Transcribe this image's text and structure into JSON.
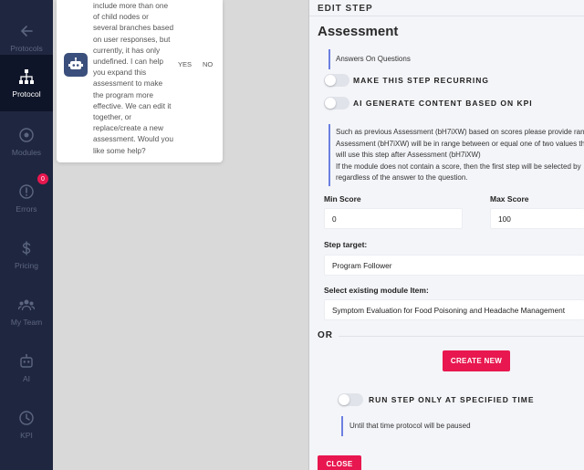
{
  "sidebar": {
    "items": [
      {
        "label": "Protocols",
        "icon": "arrow-left-icon"
      },
      {
        "label": "Protocol",
        "icon": "hierarchy-icon",
        "active": true
      },
      {
        "label": "Modules",
        "icon": "modules-icon"
      },
      {
        "label": "Errors",
        "icon": "error-icon",
        "badge": "0"
      },
      {
        "label": "Pricing",
        "icon": "dollar-icon"
      },
      {
        "label": "My Team",
        "icon": "team-icon"
      },
      {
        "label": "AI",
        "icon": "robot-icon"
      },
      {
        "label": "KPI",
        "icon": "clock-icon"
      }
    ]
  },
  "chat": {
    "message": "include more than one\nof child nodes or\nseveral branches based\non user responses, but\ncurrently, it has only\nundefined. I can help\nyou expand this\nassessment to make\nthe program more\neffective. We can edit it\ntogether, or\nreplace/create a new\nassessment. Would you\nlike some help?",
    "yes_label": "YES",
    "no_label": "NO"
  },
  "panel": {
    "title": "EDIT STEP",
    "heading": "Assessment",
    "answers_note": "Answers On Questions",
    "toggle_recurring": "MAKE THIS STEP RECURRING",
    "toggle_ai": "AI GENERATE CONTENT BASED ON KPI",
    "info_note": "Such as previous Assessment (bH7iXW) based on scores please provide range\nAssessment (bH7iXW) will be in range between or equal one of two values th\nwill use this step after Assessment (bH7iXW)\nIf the module does not contain a score, then the first step will be selected by\nregardless of the answer to the question.",
    "min_score_label": "Min Score",
    "min_score_value": "0",
    "max_score_label": "Max Score",
    "max_score_value": "100",
    "step_target_label": "Step target:",
    "step_target_value": "Program Follower",
    "module_item_label": "Select existing module Item:",
    "module_item_value": "Symptom Evaluation for Food Poisoning and Headache Management",
    "or_label": "OR",
    "create_new_label": "CREATE NEW",
    "toggle_specified_time": "RUN STEP ONLY AT SPECIFIED TIME",
    "time_note": "Until that time protocol will be paused",
    "close_label": "CLOSE"
  },
  "colors": {
    "sidebar_bg": "#1f2740",
    "accent": "#e8174f",
    "note_border": "#6b7fe0"
  }
}
